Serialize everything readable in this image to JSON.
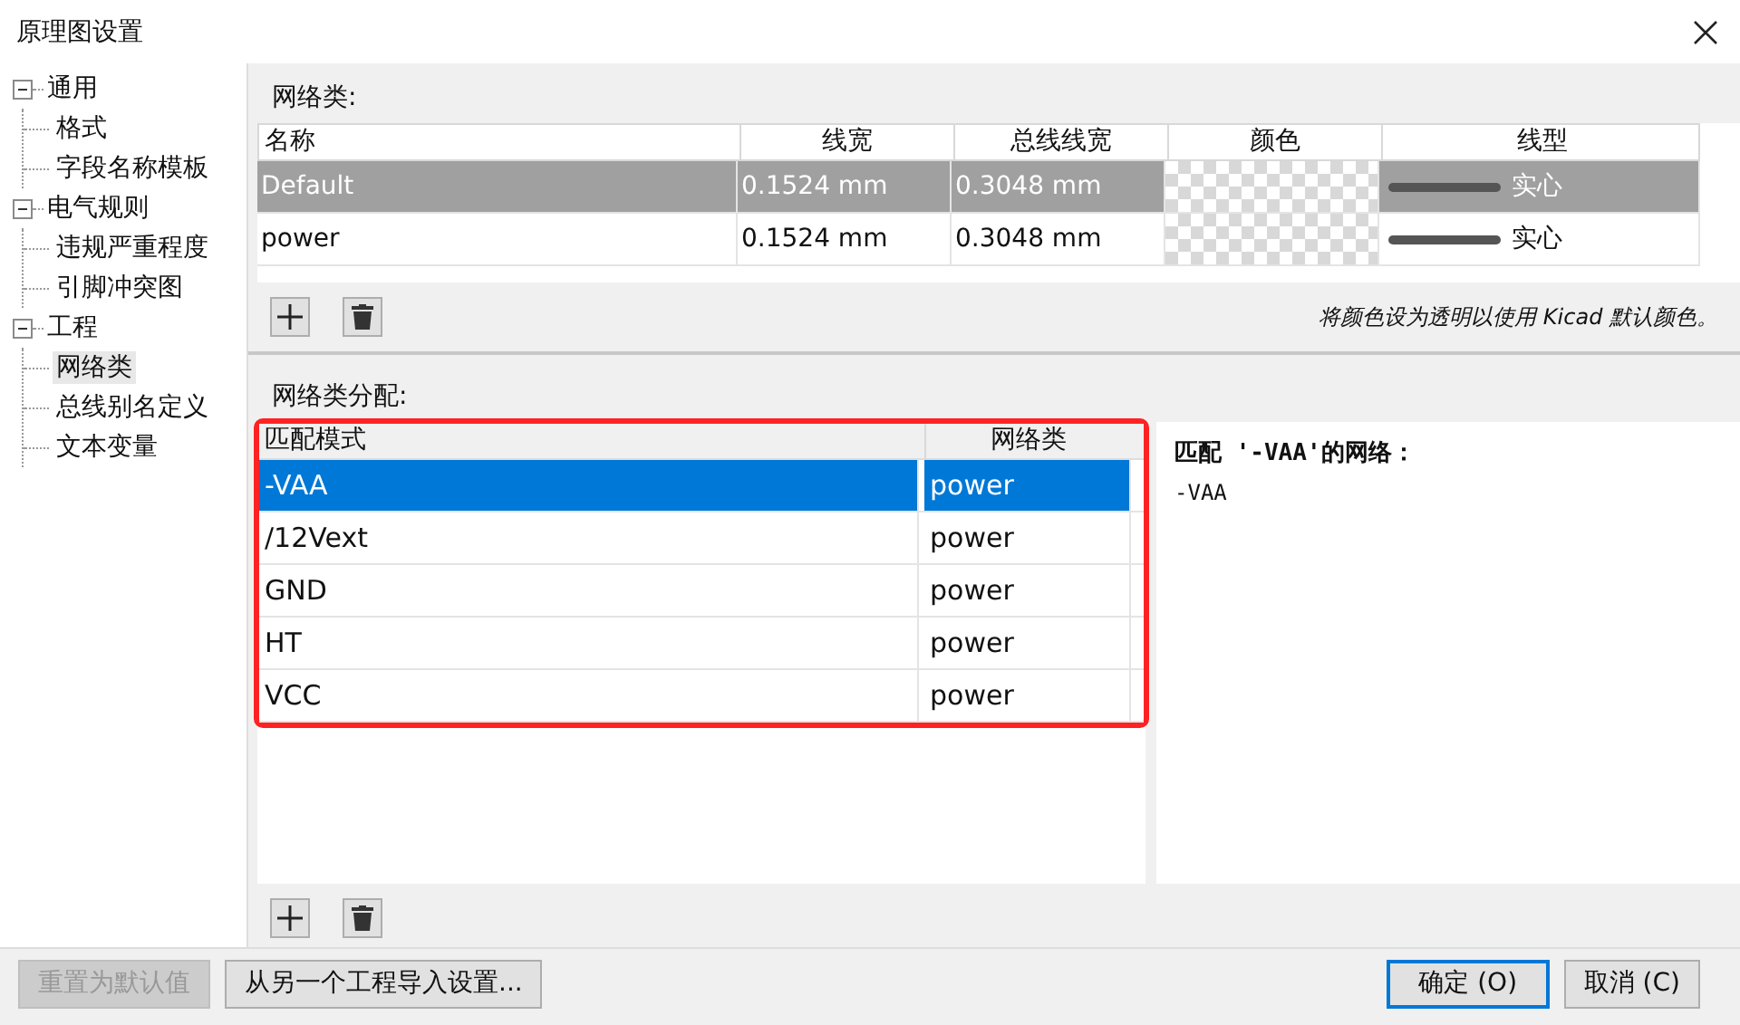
{
  "window": {
    "title": "原理图设置"
  },
  "sidebar": {
    "items": [
      {
        "label": "通用",
        "expanded": true,
        "selected": false,
        "children": [
          {
            "label": "格式",
            "selected": false
          },
          {
            "label": "字段名称模板",
            "selected": false
          }
        ]
      },
      {
        "label": "电气规则",
        "expanded": true,
        "selected": false,
        "children": [
          {
            "label": "违规严重程度",
            "selected": false
          },
          {
            "label": "引脚冲突图",
            "selected": false
          }
        ]
      },
      {
        "label": "工程",
        "expanded": true,
        "selected": false,
        "children": [
          {
            "label": "网络类",
            "selected": true
          },
          {
            "label": "总线别名定义",
            "selected": false
          },
          {
            "label": "文本变量",
            "selected": false
          }
        ]
      }
    ]
  },
  "net_classes": {
    "label": "网络类:",
    "columns": [
      "名称",
      "线宽",
      "总线线宽",
      "颜色",
      "线型"
    ],
    "rows": [
      {
        "name": "Default",
        "wire_width": "0.1524 mm",
        "bus_width": "0.3048 mm",
        "line_style": "实心",
        "selected": true
      },
      {
        "name": "power",
        "wire_width": "0.1524 mm",
        "bus_width": "0.3048 mm",
        "line_style": "实心",
        "selected": false
      }
    ],
    "note": "将颜色设为透明以使用 Kicad 默认颜色。"
  },
  "assignments": {
    "label": "网络类分配:",
    "columns": [
      "匹配模式",
      "网络类"
    ],
    "rows": [
      {
        "pattern": "-VAA",
        "net_class": "power",
        "selected": true
      },
      {
        "pattern": "/12Vext",
        "net_class": "power",
        "selected": false
      },
      {
        "pattern": "GND",
        "net_class": "power",
        "selected": false
      },
      {
        "pattern": "HT",
        "net_class": "power",
        "selected": false
      },
      {
        "pattern": "VCC",
        "net_class": "power",
        "selected": false
      }
    ],
    "preview_title": "匹配 '-VAA'的网络：",
    "preview_items": [
      "-VAA"
    ]
  },
  "buttons": [
    {
      "label": "重置为默认值",
      "disabled": true,
      "default": false
    },
    {
      "label": "从另一个工程导入设置...",
      "disabled": false,
      "default": false
    },
    {
      "label": "确定 (O)",
      "disabled": false,
      "default": true
    },
    {
      "label": "取消 (C)",
      "disabled": false,
      "default": false
    }
  ]
}
